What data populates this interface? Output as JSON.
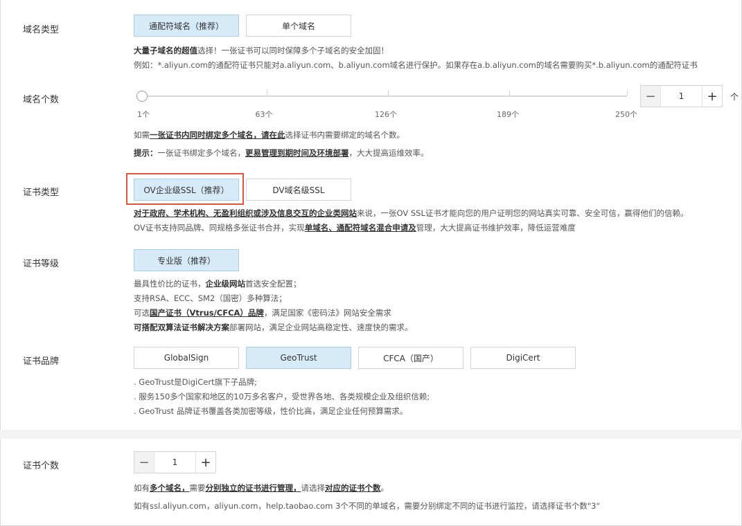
{
  "domain_type": {
    "label": "域名类型",
    "options": [
      "通配符域名（推荐）",
      "单个域名"
    ],
    "desc1_bold": "大量子域名的超值",
    "desc1_rest": "选择！一张证书可以同时保障多个子域名的安全加固！",
    "desc2": "例如：*.aliyun.com的通配符证书只能对a.aliyun.com、b.aliyun.com域名进行保护。如果存在a.b.aliyun.com的域名需要购买*.b.aliyun.com的通配符证书"
  },
  "domain_count": {
    "label": "域名个数",
    "ticks": [
      "1个",
      "63个",
      "126个",
      "189个",
      "250个"
    ],
    "slider_value": 1,
    "stepper_value": "1",
    "unit": "个",
    "hint1_pre": "如需",
    "hint1_link": "一张证书内同时绑定多个域名，请在此",
    "hint1_post": "选择证书内需要绑定的域名个数。",
    "hint2_bold": "提示：",
    "hint2_pre": "一张证书绑定多个域名，",
    "hint2_link": "更易管理到期时间及环境部署",
    "hint2_post": "，大大提高运维效率。"
  },
  "cert_type": {
    "label": "证书类型",
    "options": [
      "OV企业级SSL（推荐）",
      "DV域名级SSL"
    ],
    "desc1_link": "对于政府、学术机构、无盈利组织或涉及信息交互的企业类网站",
    "desc1_rest": "来说，一张OV SSL证书才能向您的用户证明您的网站真实可靠、安全可信，赢得他们的信赖。",
    "desc2_pre": "OV证书支持同品牌、同规格多张证书合并，实现",
    "desc2_link": "单域名、通配符域名混合申请及",
    "desc2_post": "管理，大大提高证书维护效率，降低运营难度"
  },
  "cert_level": {
    "label": "证书等级",
    "option": "专业版（推荐）",
    "line1_pre": "最具性价比的证书，",
    "line1_bold": "企业级网站",
    "line1_post": "首选安全配置；",
    "line2": "支持RSA、ECC、SM2（国密）多种算法；",
    "line3_pre": "可选",
    "line3_link": "国产证书（Vtrus/CFCA）品牌",
    "line3_post": "，满足国家《密码法》网站安全需求",
    "line4_bold": "可搭配双算法证书解决方案",
    "line4_post": "部署网站，满足企业网站高稳定性、速度快的需求。"
  },
  "cert_brand": {
    "label": "证书品牌",
    "options": [
      "GlobalSign",
      "GeoTrust",
      "CFCA（国产）",
      "DigiCert"
    ],
    "lines": [
      ". GeoTrust是DigiCert旗下子品牌;",
      ". 服务150多个国家和地区的10万多名客户，受世界各地、各类规模企业及组织信赖;",
      ". GeoTrust 品牌证书覆盖各类加密等级，性价比高，满足企业任何预算需求。"
    ]
  },
  "cert_count": {
    "label": "证书个数",
    "stepper_value": "1",
    "hint1_pre": "如有",
    "hint1_link1": "多个域名，",
    "hint1_mid": "需要",
    "hint1_link2": "分别独立的证书进行管理，",
    "hint1_mid2": "请选择",
    "hint1_link3": "对应的证书个数",
    "hint1_post": "。",
    "hint2": "如有ssl.aliyun.com，aliyun.com，help.taobao.com 3个不同的单域名，需要分别绑定不同的证书进行监控，请选择证书个数\"3\""
  },
  "colors": {
    "selected_bg": "#d6ebf7",
    "highlight": "#e5533d"
  }
}
